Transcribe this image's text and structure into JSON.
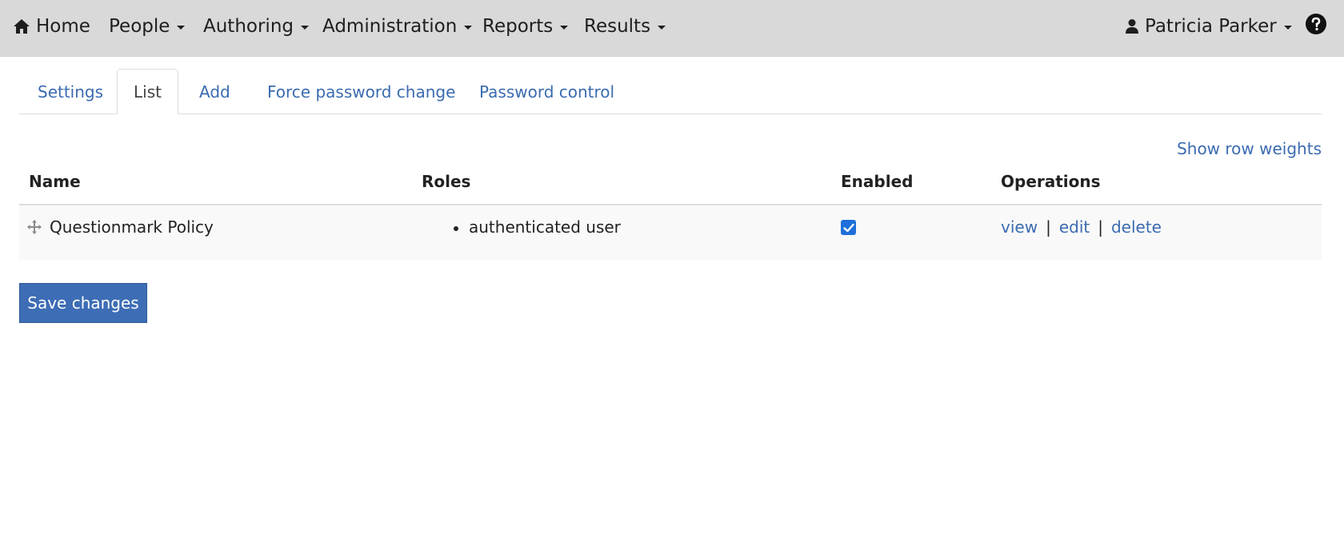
{
  "navbar": {
    "home": "Home",
    "people": "People",
    "authoring": "Authoring",
    "administration": "Administration",
    "reports": "Reports",
    "results": "Results",
    "user": "Patricia Parker"
  },
  "tabs": [
    "Settings",
    "List",
    "Add",
    "Force password change",
    "Password control"
  ],
  "active_tab": "List",
  "show_row_weights": "Show row weights",
  "table": {
    "headers": [
      "Name",
      "Roles",
      "Enabled",
      "Operations"
    ],
    "rows": [
      {
        "name": "Questionmark Policy",
        "roles": [
          "authenticated user"
        ],
        "enabled": true,
        "operations": [
          "view",
          "edit",
          "delete"
        ]
      }
    ]
  },
  "separator": "|",
  "save_button": "Save changes",
  "colors": {
    "navbar_bg": "#d9d9d9",
    "link": "#3b6bb0",
    "button": "#3d6db5",
    "checkbox": "#1e6fd9"
  }
}
